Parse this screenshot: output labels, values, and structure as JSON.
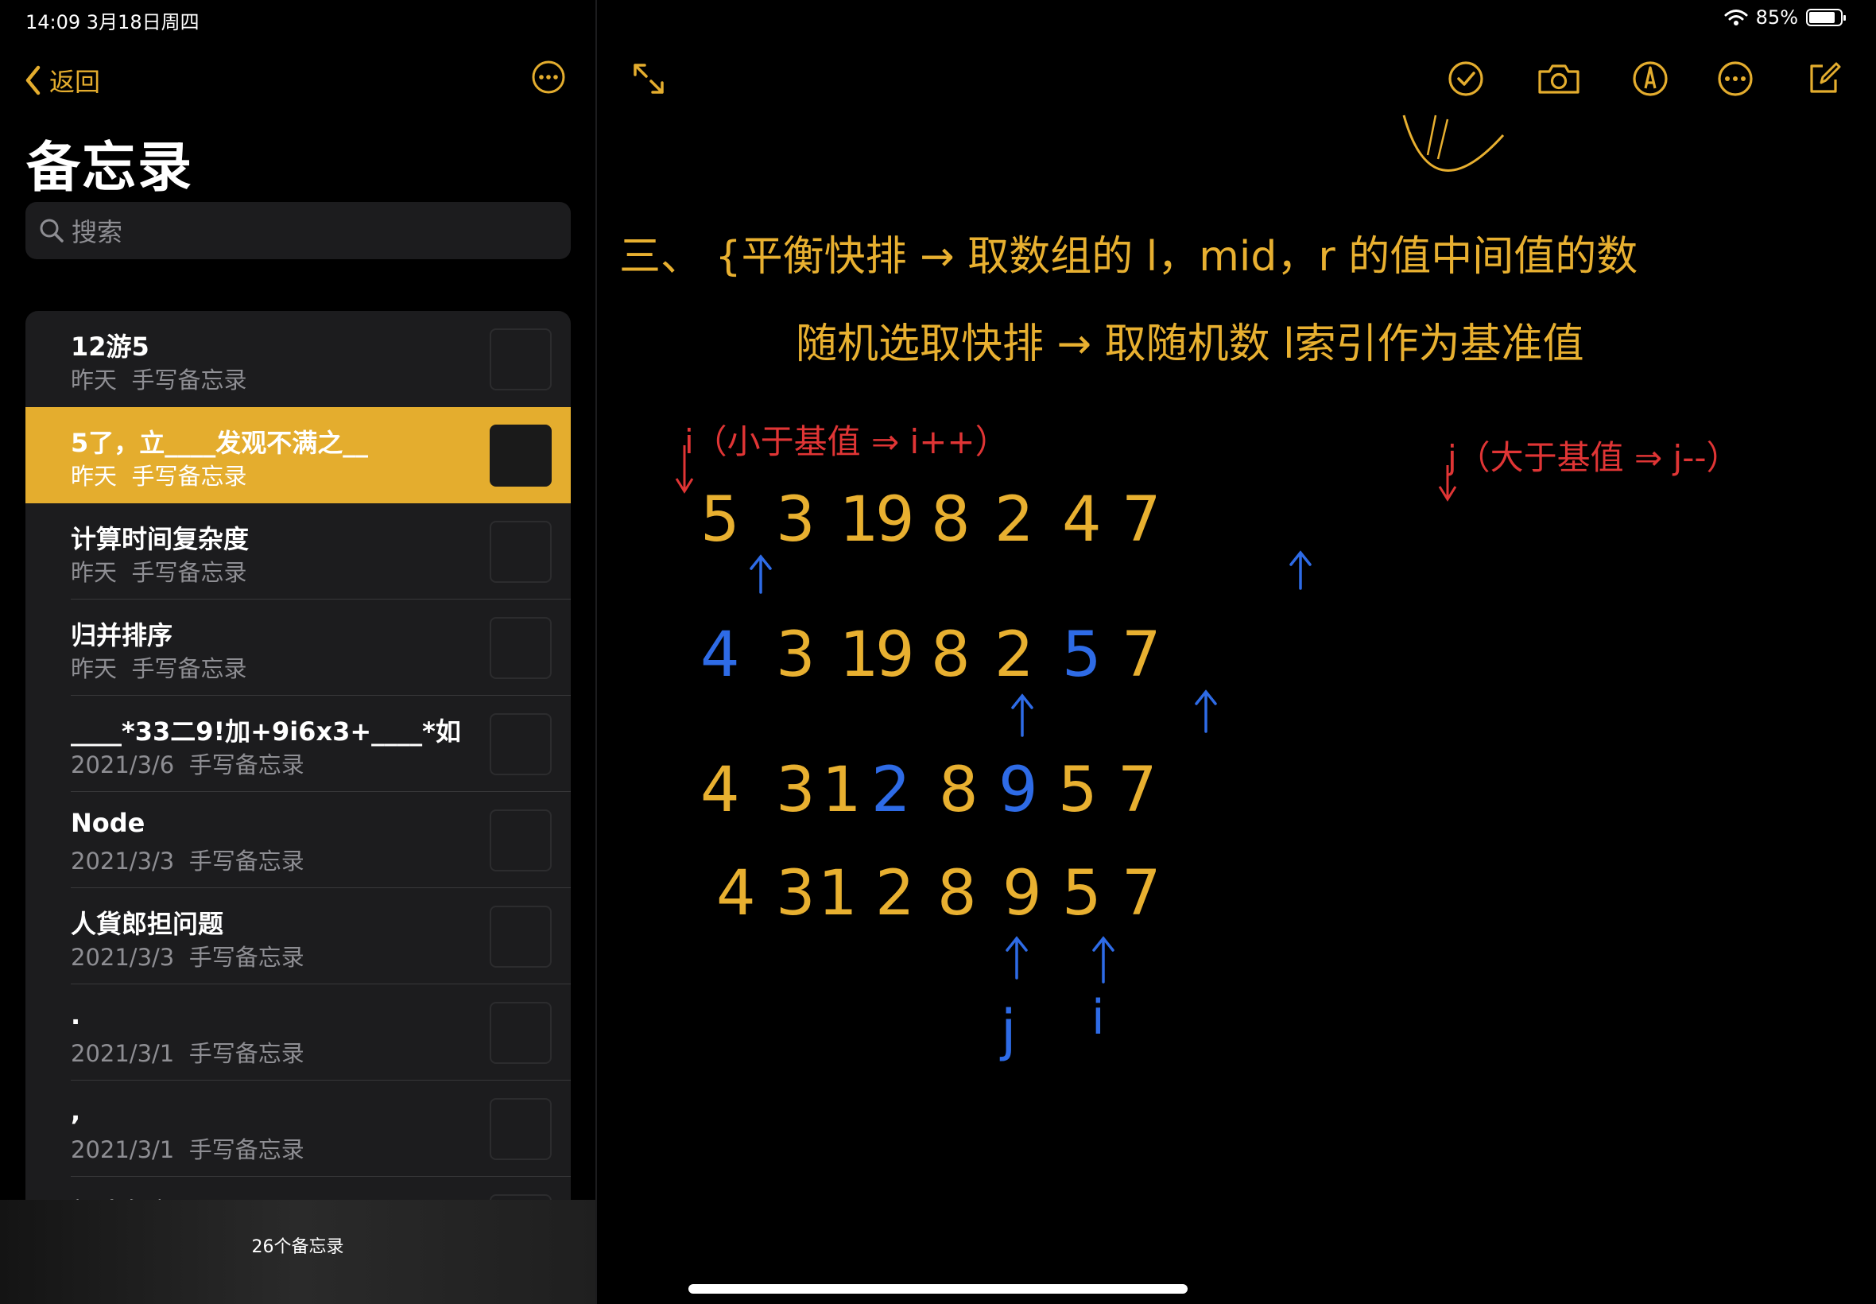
{
  "status": {
    "time": "14:09 3月18日周四",
    "battery": "85%",
    "battery_level": 0.85
  },
  "nav": {
    "back_label": "返回",
    "title": "备忘录"
  },
  "search": {
    "placeholder": "搜索"
  },
  "notes": [
    {
      "title": "12游5",
      "date": "昨天",
      "type": "手写备忘录",
      "selected": false
    },
    {
      "title": "5了，立____发观不满之__",
      "date": "昨天",
      "type": "手写备忘录",
      "selected": true
    },
    {
      "title": "计算时间复杂度",
      "date": "昨天",
      "type": "手写备忘录",
      "selected": false
    },
    {
      "title": "归并排序",
      "date": "昨天",
      "type": "手写备忘录",
      "selected": false
    },
    {
      "title": "____*33二9!加+9i6x3+____*如",
      "date": "2021/3/6",
      "type": "手写备忘录",
      "selected": false
    },
    {
      "title": "Node",
      "date": "2021/3/3",
      "type": "手写备忘录",
      "selected": false
    },
    {
      "title": "人貨郎担问题",
      "date": "2021/3/3",
      "type": "手写备忘录",
      "selected": false
    },
    {
      "title": ".",
      "date": "2021/3/1",
      "type": "手写备忘录",
      "selected": false
    },
    {
      "title": ",",
      "date": "2021/3/1",
      "type": "手写备忘录",
      "selected": false
    },
    {
      "title": "新建备忘录",
      "date": "",
      "type": "",
      "selected": false
    }
  ],
  "footer": {
    "count_label": "26个备忘录"
  },
  "colors": {
    "accent": "#e4ad2e",
    "ink_yellow": "#e8b030",
    "ink_blue": "#2e6be6",
    "ink_red": "#e03535"
  },
  "handwriting": {
    "line1": "三、 {平衡快排 → 取数组的 l，mid，r 的值中间值的数",
    "line2": "随机选取快排 → 取随机数 l索引作为基准值",
    "label_i": "i（小于基值 ⇒ i++）",
    "label_j": "j（大于基值 ⇒ j--）",
    "rows": [
      [
        "5",
        "3",
        "1",
        "9",
        "8",
        "2",
        "4",
        "7"
      ],
      [
        "4",
        "3",
        "1",
        "9",
        "8",
        "2",
        "5",
        "7"
      ],
      [
        "4",
        "3",
        "1",
        "2",
        "8",
        "9",
        "5",
        "7"
      ],
      [
        "4",
        "3",
        "1",
        "2",
        "8",
        "9",
        "5",
        "7"
      ]
    ],
    "pointer_j": "j",
    "pointer_i": "i"
  },
  "toolbar": [
    "checklist-icon",
    "camera-icon",
    "markup-pen-icon",
    "more-icon",
    "compose-icon"
  ]
}
